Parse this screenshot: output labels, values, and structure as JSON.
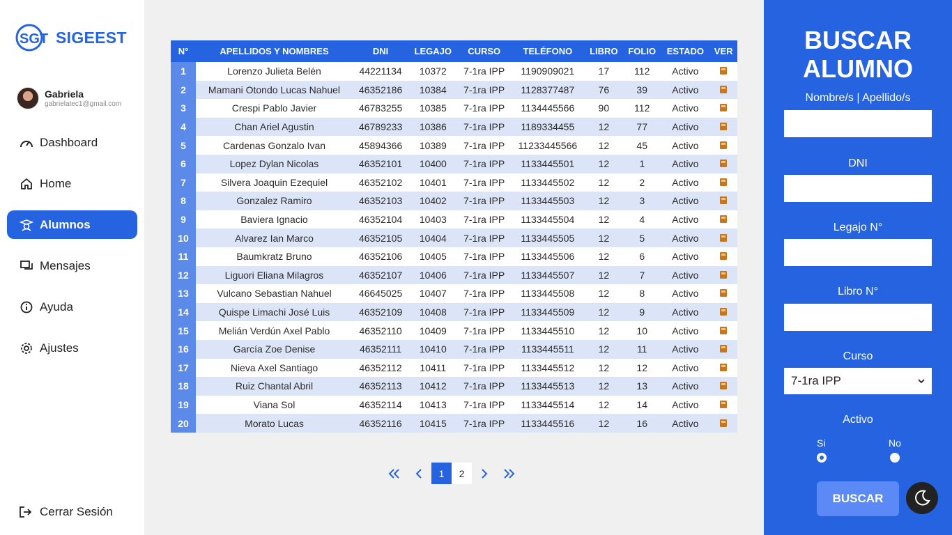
{
  "app": {
    "name": "SIGEEST"
  },
  "user": {
    "name": "Gabriela",
    "email": "gabrielatec1@gmail.com"
  },
  "nav": [
    {
      "label": "Dashboard",
      "icon": "dashboard-icon",
      "active": false
    },
    {
      "label": "Home",
      "icon": "home-icon",
      "active": false
    },
    {
      "label": "Alumnos",
      "icon": "student-icon",
      "active": true
    },
    {
      "label": "Mensajes",
      "icon": "messages-icon",
      "active": false
    },
    {
      "label": "Ayuda",
      "icon": "info-icon",
      "active": false
    },
    {
      "label": "Ajustes",
      "icon": "gear-icon",
      "active": false
    }
  ],
  "logout": {
    "label": "Cerrar Sesión",
    "icon": "logout-icon"
  },
  "table": {
    "headers": [
      "N°",
      "APELLIDOS Y NOMBRES",
      "DNI",
      "LEGAJO",
      "CURSO",
      "TELÉFONO",
      "LIBRO",
      "FOLIO",
      "ESTADO",
      "VER"
    ],
    "rows": [
      [
        "1",
        "Lorenzo Julieta Belén",
        "44221134",
        "10372",
        "7-1ra IPP",
        "1190909021",
        "17",
        "112",
        "Activo"
      ],
      [
        "2",
        "Mamani Otondo Lucas Nahuel",
        "46352186",
        "10384",
        "7-1ra IPP",
        "1128377487",
        "76",
        "39",
        "Activo"
      ],
      [
        "3",
        "Crespi Pablo Javier",
        "46783255",
        "10385",
        "7-1ra IPP",
        "1134445566",
        "90",
        "112",
        "Activo"
      ],
      [
        "4",
        "Chan Ariel Agustin",
        "46789233",
        "10386",
        "7-1ra IPP",
        "1189334455",
        "12",
        "77",
        "Activo"
      ],
      [
        "5",
        "Cardenas Gonzalo Ivan",
        "45894366",
        "10389",
        "7-1ra IPP",
        "11233445566",
        "12",
        "45",
        "Activo"
      ],
      [
        "6",
        "Lopez Dylan Nicolas",
        "46352101",
        "10400",
        "7-1ra IPP",
        "1133445501",
        "12",
        "1",
        "Activo"
      ],
      [
        "7",
        "Silvera Joaquin Ezequiel",
        "46352102",
        "10401",
        "7-1ra IPP",
        "1133445502",
        "12",
        "2",
        "Activo"
      ],
      [
        "8",
        "Gonzalez Ramiro",
        "46352103",
        "10402",
        "7-1ra IPP",
        "1133445503",
        "12",
        "3",
        "Activo"
      ],
      [
        "9",
        "Baviera Ignacio",
        "46352104",
        "10403",
        "7-1ra IPP",
        "1133445504",
        "12",
        "4",
        "Activo"
      ],
      [
        "10",
        "Alvarez Ian Marco",
        "46352105",
        "10404",
        "7-1ra IPP",
        "1133445505",
        "12",
        "5",
        "Activo"
      ],
      [
        "11",
        "Baumkratz Bruno",
        "46352106",
        "10405",
        "7-1ra IPP",
        "1133445506",
        "12",
        "6",
        "Activo"
      ],
      [
        "12",
        "Liguori Eliana Milagros",
        "46352107",
        "10406",
        "7-1ra IPP",
        "1133445507",
        "12",
        "7",
        "Activo"
      ],
      [
        "13",
        "Vulcano Sebastian Nahuel",
        "46645025",
        "10407",
        "7-1ra IPP",
        "1133445508",
        "12",
        "8",
        "Activo"
      ],
      [
        "14",
        "Quispe Limachi José Luis",
        "46352109",
        "10408",
        "7-1ra IPP",
        "1133445509",
        "12",
        "9",
        "Activo"
      ],
      [
        "15",
        "Melián Verdún Axel Pablo",
        "46352110",
        "10409",
        "7-1ra IPP",
        "1133445510",
        "12",
        "10",
        "Activo"
      ],
      [
        "16",
        "García Zoe Denise",
        "46352111",
        "10410",
        "7-1ra IPP",
        "1133445511",
        "12",
        "11",
        "Activo"
      ],
      [
        "17",
        "Nieva Axel Santiago",
        "46352112",
        "10411",
        "7-1ra IPP",
        "1133445512",
        "12",
        "12",
        "Activo"
      ],
      [
        "18",
        "Ruiz Chantal Abril",
        "46352113",
        "10412",
        "7-1ra IPP",
        "1133445513",
        "12",
        "13",
        "Activo"
      ],
      [
        "19",
        "Viana Sol",
        "46352114",
        "10413",
        "7-1ra IPP",
        "1133445514",
        "12",
        "14",
        "Activo"
      ],
      [
        "20",
        "Morato Lucas",
        "46352116",
        "10415",
        "7-1ra IPP",
        "1133445516",
        "12",
        "16",
        "Activo"
      ]
    ],
    "row_action_icon": "book-icon"
  },
  "pagination": {
    "pages": [
      "1",
      "2"
    ],
    "current": "1"
  },
  "search": {
    "title_line1": "BUSCAR",
    "title_line2": "ALUMNO",
    "name_label": "Nombre/s | Apellido/s",
    "name_value": "",
    "dni_label": "DNI",
    "dni_value": "",
    "legajo_label": "Legajo N°",
    "legajo_value": "",
    "libro_label": "Libro N°",
    "libro_value": "",
    "curso_label": "Curso",
    "curso_selected": "7-1ra IPP",
    "activo_label": "Activo",
    "si_label": "Si",
    "no_label": "No",
    "submit_label": "BUSCAR"
  },
  "colors": {
    "primary": "#2563e0",
    "row_alt": "#dbe5f7",
    "index_col": "#5b8ae8",
    "button": "#5b8af6"
  }
}
